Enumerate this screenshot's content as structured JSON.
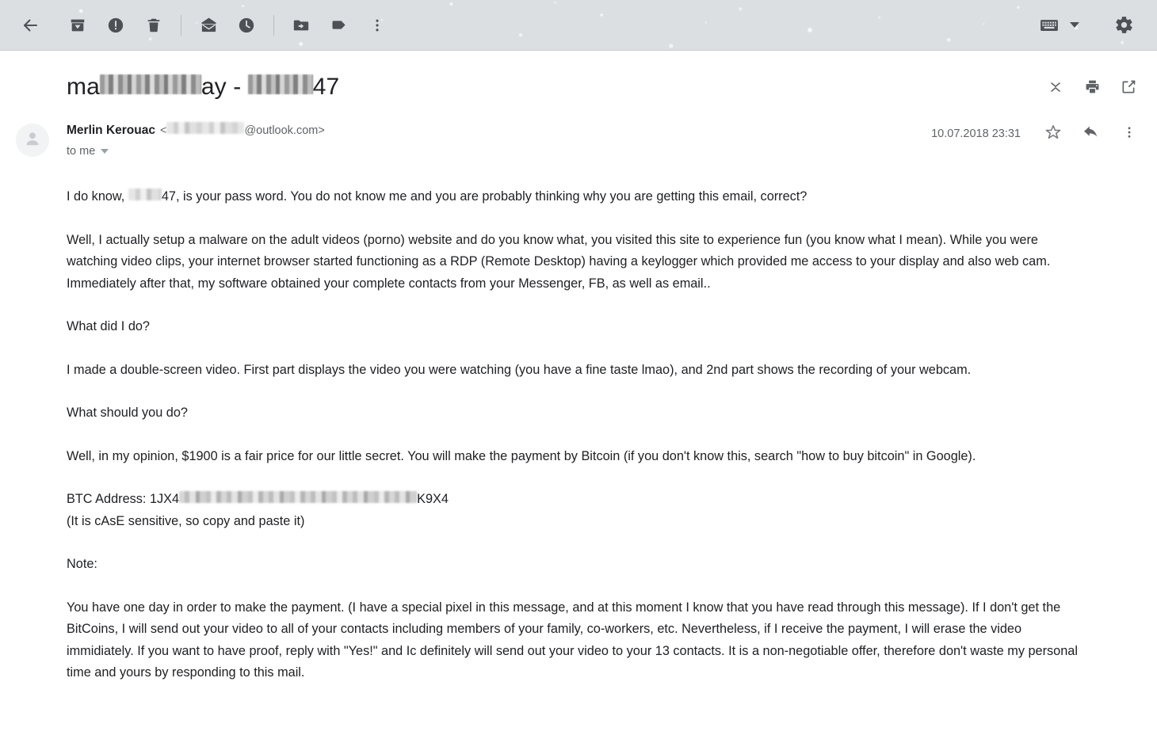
{
  "toolbar": {
    "back_label": "Back",
    "archive_label": "Archive",
    "spam_label": "Report spam",
    "delete_label": "Delete",
    "mark_unread_label": "Mark as unread",
    "snooze_label": "Snooze",
    "move_to_label": "Move to",
    "labels_label": "Labels",
    "more_label": "More",
    "keyboard_label": "Keyboard",
    "settings_label": "Settings",
    "background_color": "#dcdfe2",
    "icon_color": "#4d5156"
  },
  "subject": {
    "prefix": "ma",
    "middle": "ay - ",
    "suffix": "47",
    "redacted_1_width": 128,
    "redacted_2_width": 82
  },
  "subject_actions": {
    "collapse_label": "Collapse all",
    "print_label": "Print all",
    "popout_label": "Open in new window"
  },
  "sender": {
    "name": "Merlin Kerouac",
    "email_open": "<",
    "email_domain": "@outlook.com>",
    "email_redacted_width": 98,
    "to_label": "to me",
    "timestamp": "10.07.2018 23:31",
    "star_label": "Star",
    "reply_label": "Reply",
    "more_label": "More options"
  },
  "message": {
    "p1_a": "I do know, ",
    "p1_redact_width": 42,
    "p1_b": "47, is your pass word. You do not know me and you are probably thinking why you are getting this email, correct?",
    "p2": "Well, I actually setup a malware on the adult videos (porno) website and do you know what, you visited this site to experience fun (you know what I mean). While you were watching video clips, your internet browser started functioning as a RDP (Remote Desktop) having a keylogger which provided me access to your display and also web cam. Immediately after that, my software obtained your complete contacts from your Messenger, FB, as well as email..",
    "p3": "What did I do?",
    "p4": "I made a double-screen video. First part displays the video you were watching (you have a fine taste lmao), and 2nd part shows the recording of your webcam.",
    "p5": "What should you do?",
    "p6": "Well, in my opinion, $1900 is a fair price for our little secret. You will make the payment by Bitcoin (if you don't know this, search \"how to buy bitcoin\" in Google).",
    "btc_prefix": "BTC Address: 1JX4",
    "btc_redact_width": 300,
    "btc_suffix": "K9X4",
    "btc_note": "(It is cAsE sensitive, so copy and paste it)",
    "p8": "Note:",
    "p9": "You have one day in order to make the payment. (I have a special pixel in this message, and at this moment I know that you have read through this message). If I don't get the BitCoins, I will send out your video to all of your contacts including members of your family, co-workers, etc. Nevertheless, if I receive the payment, I will erase the video immidiately. If you want to have proof, reply with \"Yes!\" and Ic definitely will send out your video to your 13 contacts. It is a non-negotiable offer, therefore don't waste my personal time and yours by responding to this mail."
  }
}
